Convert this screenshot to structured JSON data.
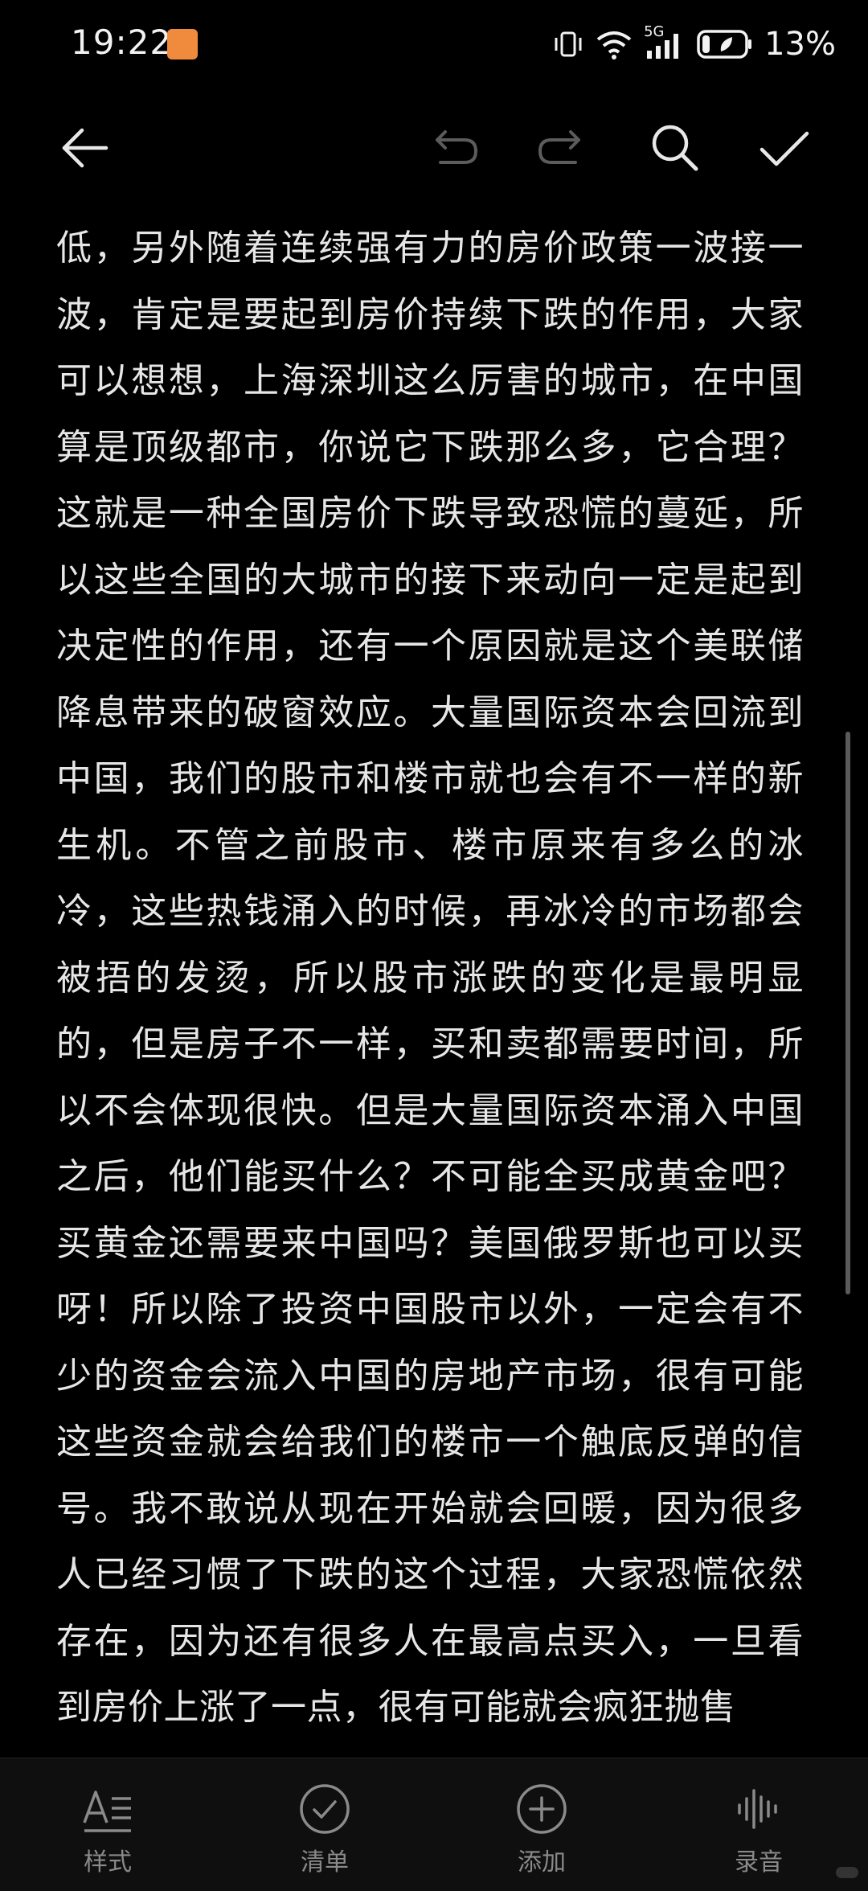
{
  "status": {
    "time": "19:22",
    "network": "5G",
    "battery": "13%"
  },
  "toolbar": {
    "back": "back-arrow-icon",
    "undo": "undo-icon",
    "redo": "redo-icon",
    "search": "search-icon",
    "confirm": "check-icon"
  },
  "note": {
    "body": "低，另外随着连续强有力的房价政策一波接一波，肯定是要起到房价持续下跌的作用，大家可以想想，上海深圳这么厉害的城市，在中国算是顶级都市，你说它下跌那么多，它合理？这就是一种全国房价下跌导致恐慌的蔓延，所以这些全国的大城市的接下来动向一定是起到决定性的作用，还有一个原因就是这个美联储降息带来的破窗效应。大量国际资本会回流到中国，我们的股市和楼市就也会有不一样的新生机。不管之前股市、楼市原来有多么的冰冷，这些热钱涌入的时候，再冰冷的市场都会被捂的发烫，所以股市涨跌的变化是最明显的，但是房子不一样，买和卖都需要时间，所以不会体现很快。但是大量国际资本涌入中国之后，他们能买什么？不可能全买成黄金吧？买黄金还需要来中国吗？美国俄罗斯也可以买呀！所以除了投资中国股市以外，一定会有不少的资金会流入中国的房地产市场，很有可能这些资金就会给我们的楼市一个触底反弹的信号。我不敢说从现在开始就会回暖，因为很多人已经习惯了下跌的这个过程，大家恐慌依然存在，因为还有很多人在最高点买入，一旦看到房价上涨了一点，很有可能就会疯狂抛售"
  },
  "bottom_bar": {
    "items": [
      {
        "label": "样式",
        "icon": "text-style-icon"
      },
      {
        "label": "清单",
        "icon": "checklist-icon"
      },
      {
        "label": "添加",
        "icon": "add-icon"
      },
      {
        "label": "录音",
        "icon": "audio-wave-icon"
      }
    ]
  }
}
